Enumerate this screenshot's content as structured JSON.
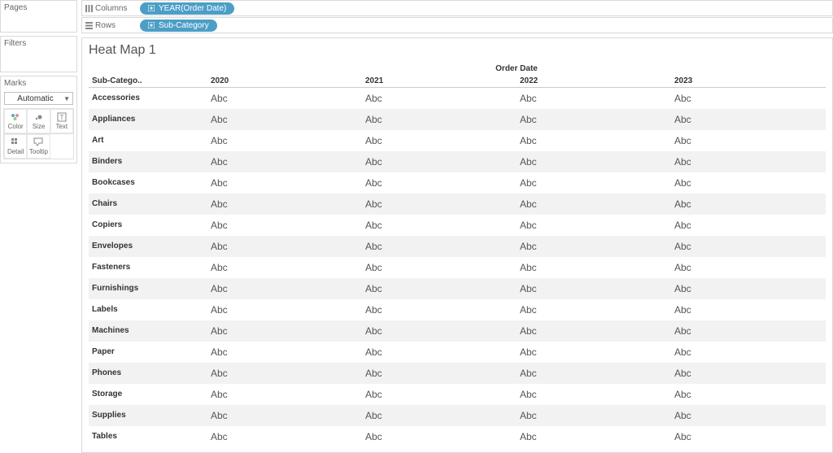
{
  "side": {
    "pages_title": "Pages",
    "filters_title": "Filters",
    "marks_title": "Marks",
    "marks_select": "Automatic",
    "cards": [
      {
        "name": "color-card",
        "label": "Color"
      },
      {
        "name": "size-card",
        "label": "Size"
      },
      {
        "name": "text-card",
        "label": "Text"
      },
      {
        "name": "detail-card",
        "label": "Detail"
      },
      {
        "name": "tooltip-card",
        "label": "Tooltip"
      }
    ]
  },
  "shelves": {
    "columns_label": "Columns",
    "columns_pill": "YEAR(Order Date)",
    "rows_label": "Rows",
    "rows_pill": "Sub-Category"
  },
  "viz": {
    "title": "Heat Map 1",
    "col_dimension_label": "Order Date",
    "row_dimension_label": "Sub-Catego..",
    "columns": [
      "2020",
      "2021",
      "2022",
      "2023"
    ],
    "rows": [
      "Accessories",
      "Appliances",
      "Art",
      "Binders",
      "Bookcases",
      "Chairs",
      "Copiers",
      "Envelopes",
      "Fasteners",
      "Furnishings",
      "Labels",
      "Machines",
      "Paper",
      "Phones",
      "Storage",
      "Supplies",
      "Tables"
    ],
    "cell_placeholder": "Abc"
  },
  "chart_data": {
    "type": "table",
    "row_field": "Sub-Category",
    "col_field": "YEAR(Order Date)",
    "columns": [
      "2020",
      "2021",
      "2022",
      "2023"
    ],
    "rows": [
      "Accessories",
      "Appliances",
      "Art",
      "Binders",
      "Bookcases",
      "Chairs",
      "Copiers",
      "Envelopes",
      "Fasteners",
      "Furnishings",
      "Labels",
      "Machines",
      "Paper",
      "Phones",
      "Storage",
      "Supplies",
      "Tables"
    ],
    "cell_value": "Abc",
    "note": "Placeholder crosstab — every cell displays the literal text 'Abc' (no numeric measure on the Text mark yet)."
  }
}
